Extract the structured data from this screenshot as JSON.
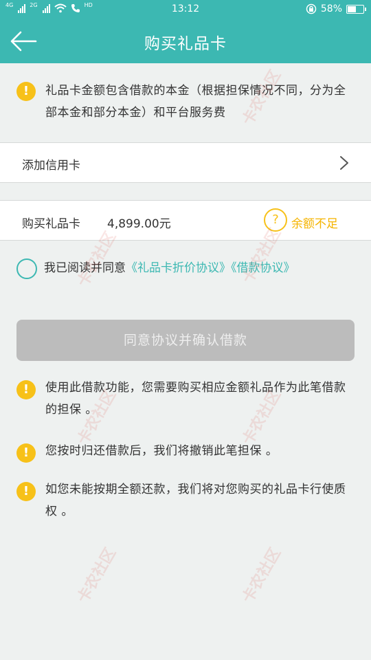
{
  "status_bar": {
    "sim1_label": "4G",
    "sim2_label": "2G",
    "hd_label": "HD",
    "time": "13:12",
    "battery": "58%",
    "battery_level": 0.58
  },
  "nav": {
    "title": "购买礼品卡"
  },
  "notice_top": {
    "icon": "warning-icon",
    "text": "礼品卡金额包含借款的本金（根据担保情况不同，分为全部本金和部分本金）和平台服务费"
  },
  "add_card": {
    "label": "添加信用卡"
  },
  "purchase": {
    "label": "购买礼品卡",
    "amount": "4,899.00元",
    "help_symbol": "?",
    "status": "余额不足"
  },
  "agreement": {
    "prefix": "我已阅读并同意",
    "link1": "《礼品卡折价协议》",
    "link2": "《借款协议》"
  },
  "confirm_button": {
    "label": "同意协议并确认借款"
  },
  "notes": [
    {
      "text": "使用此借款功能，您需要购买相应金额礼品作为此笔借款的担保 。"
    },
    {
      "text": "您按时归还借款后，我们将撤销此笔担保 。"
    },
    {
      "text": "如您未能按期全额还款，我们将对您购买的礼品卡行使质权 。"
    }
  ],
  "warn_symbol": "!",
  "watermark": "卡农社区",
  "colors": {
    "accent": "#3cb8b2",
    "warning": "#f7c119",
    "status_warning": "#f5b400",
    "disabled_button": "#bcbcbc",
    "background": "#eef1f0"
  }
}
